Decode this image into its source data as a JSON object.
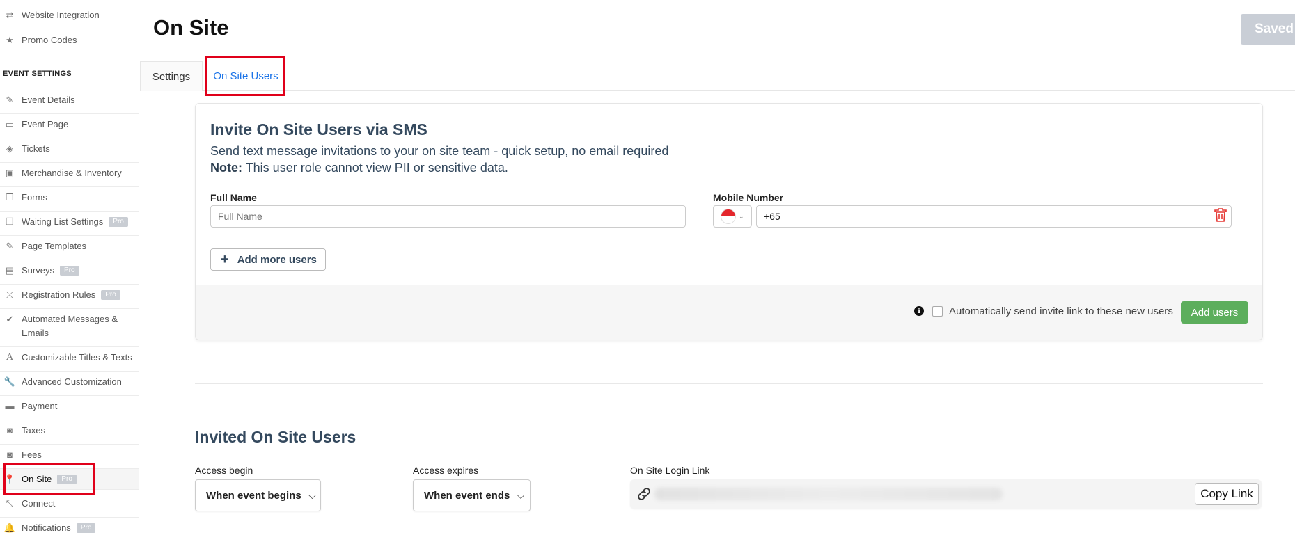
{
  "sidebar": {
    "top_items": [
      {
        "label": "Website Integration",
        "icon": "arrows-swap-icon"
      },
      {
        "label": "Promo Codes",
        "icon": "star-icon"
      }
    ],
    "section_header": "EVENT SETTINGS",
    "items": [
      {
        "label": "Event Details",
        "icon": "edit-icon"
      },
      {
        "label": "Event Page",
        "icon": "monitor-icon"
      },
      {
        "label": "Tickets",
        "icon": "ticket-icon"
      },
      {
        "label": "Merchandise & Inventory",
        "icon": "briefcase-icon"
      },
      {
        "label": "Forms",
        "icon": "copy-icon"
      },
      {
        "label": "Waiting List Settings",
        "icon": "copy-icon",
        "badge": "Pro"
      },
      {
        "label": "Page Templates",
        "icon": "edit-icon"
      },
      {
        "label": "Surveys",
        "icon": "file-icon",
        "badge": "Pro"
      },
      {
        "label": "Registration Rules",
        "icon": "shuffle-icon",
        "badge": "Pro"
      },
      {
        "label": "Automated Messages & Emails",
        "icon": "check-circle-icon"
      },
      {
        "label": "Customizable Titles & Texts",
        "icon": "font-icon"
      },
      {
        "label": "Advanced Customization",
        "icon": "wrench-icon"
      },
      {
        "label": "Payment",
        "icon": "credit-card-icon"
      },
      {
        "label": "Taxes",
        "icon": "money-icon"
      },
      {
        "label": "Fees",
        "icon": "money-icon"
      },
      {
        "label": "On Site",
        "icon": "map-pin-icon",
        "badge": "Pro"
      },
      {
        "label": "Connect",
        "icon": "compress-icon"
      },
      {
        "label": "Notifications",
        "icon": "bell-icon",
        "badge": "Pro"
      }
    ]
  },
  "header": {
    "title": "On Site",
    "saved_label": "Saved"
  },
  "tabs": [
    {
      "label": "Settings"
    },
    {
      "label": "On Site Users"
    }
  ],
  "invite": {
    "title": "Invite On Site Users via SMS",
    "subtitle": "Send text message invitations to your on site team - quick setup, no email required",
    "note_bold": "Note:",
    "note_text": " This user role cannot view PII or sensitive data.",
    "full_name_label": "Full Name",
    "full_name_placeholder": "Full Name",
    "mobile_label": "Mobile Number",
    "mobile_value": "+65",
    "add_more_label": "Add more users",
    "auto_send_label": "Automatically send invite link to these new users",
    "add_users_label": "Add users",
    "info_glyph": "i"
  },
  "invited": {
    "title": "Invited On Site Users",
    "access_begin_label": "Access begin",
    "access_begin_value": "When event begins",
    "access_expires_label": "Access expires",
    "access_expires_value": "When event ends",
    "login_link_label": "On Site Login Link",
    "copy_link_label": "Copy Link"
  },
  "colors": {
    "accent": "#1a73e8",
    "highlight_box": "#e0001a",
    "primary_green": "#5cae5c",
    "delete_red": "#e53935"
  }
}
